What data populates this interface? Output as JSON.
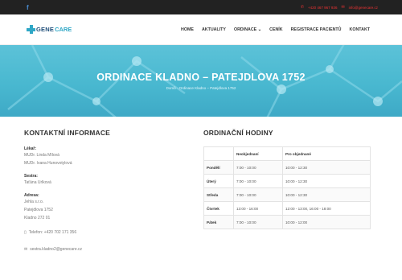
{
  "topbar": {
    "facebook": "f",
    "phone": "+420 467 967 936",
    "email": "info@genecare.cz"
  },
  "logo": {
    "gene": "GENE",
    "care": "CARE"
  },
  "menu": [
    "HOME",
    "AKTUALITY",
    "ORDINACE ⌄",
    "CENÍK",
    "REGISTRACE PACIENTŮ",
    "KONTAKT"
  ],
  "hero": {
    "title": "ORDINACE KLADNO – PATEJDLOVA 1752",
    "breadcrumb": "Domů · Ordinace Kladno – Patejdlova 1752"
  },
  "contact": {
    "heading": "KONTAKTNÍ INFORMACE",
    "doctor_label": "Lékař:",
    "doctors": [
      "MUDr. Linda Mílová",
      "MUDr. Ivana Hunovotylová"
    ],
    "nurse_label": "Sestra:",
    "nurse": "Taťána Urlková",
    "address_label": "Adresa:",
    "address": [
      "Jehla s.r.o.",
      "Patejdlova 1752",
      "Kladno 272 01"
    ],
    "phone": "Telefon: +420 702 171 356",
    "email": "sestra.kladno2@genecare.cz"
  },
  "hours": {
    "heading": "ORDINAČNÍ HODINY",
    "columns": [
      "",
      "Neobjednaní",
      "Pro objednané"
    ],
    "rows": [
      [
        "Pondělí",
        "7:00 - 10:00",
        "10:00 - 12:30"
      ],
      [
        "Úterý",
        "7:00 - 10:00",
        "10:00 - 12:30"
      ],
      [
        "Středa",
        "7:00 - 10:00",
        "10:00 - 12:30"
      ],
      [
        "Čtvrtek",
        "13:00 - 16:00",
        "12:00 - 13:00, 16:00 - 18:00"
      ],
      [
        "Pátek",
        "7:00 - 10:00",
        "10:00 - 12:00"
      ]
    ]
  },
  "colors": {
    "accent": "#2fa7c6",
    "hero": "#49b8d0",
    "dark": "#222222",
    "alert": "#ee3333"
  }
}
